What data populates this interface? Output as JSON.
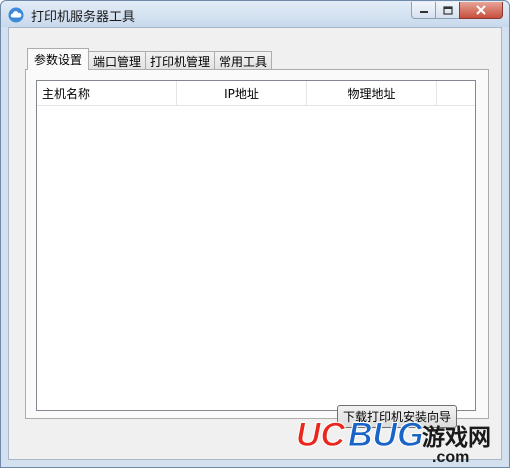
{
  "window": {
    "title": "打印机服务器工具"
  },
  "tabs": [
    {
      "label": "参数设置",
      "active": true
    },
    {
      "label": "端口管理",
      "active": false
    },
    {
      "label": "打印机管理",
      "active": false
    },
    {
      "label": "常用工具",
      "active": false
    }
  ],
  "table": {
    "columns": [
      "主机名称",
      "IP地址",
      "物理地址"
    ],
    "rows": []
  },
  "bottom_button": {
    "label": "下载打印机安装向导"
  },
  "watermark": {
    "brand": "UCBUG",
    "cn": "游戏网",
    "domain": ".com"
  },
  "colors": {
    "title_bar": "#c9d9ec",
    "close_button": "#c74e3c",
    "watermark_red": "#e8281e",
    "watermark_blue": "#1a64c8"
  }
}
